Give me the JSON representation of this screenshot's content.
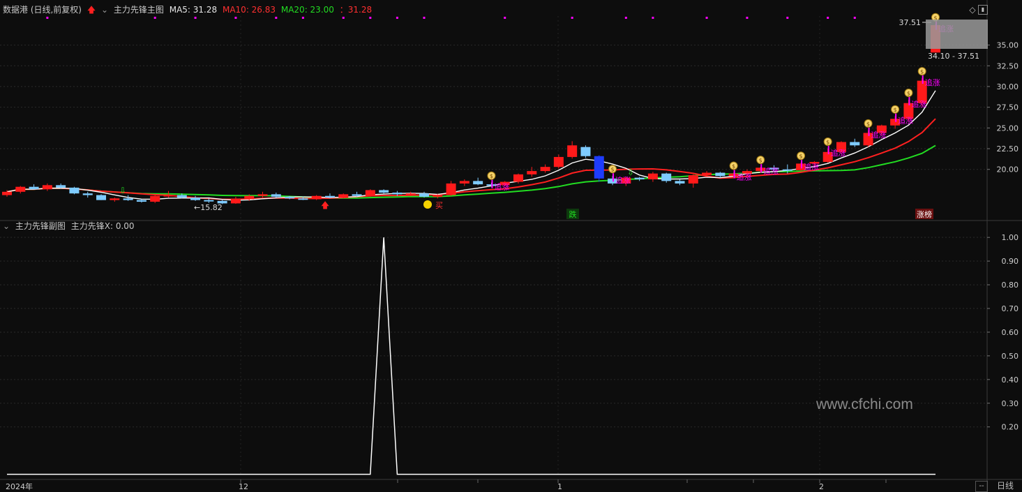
{
  "main_header": {
    "title": "数据港 (日线,前复权)",
    "indicator": "主力先锋主图",
    "ma5": "MA5: 31.28",
    "ma10": "MA10: 26.83",
    "ma20": "MA20: 23.00",
    "extra": "：31.28"
  },
  "sub_header": {
    "indicator": "主力先锋副图",
    "value": "主力先锋X: 0.00"
  },
  "annotations": {
    "high_value": "37.51",
    "range_label": "34.10 - 37.51",
    "low_value": "←15.82",
    "buy": "买",
    "fall": "跌",
    "limit_board": "涨榜",
    "chase": "追涨"
  },
  "footer": {
    "year": "2024年",
    "dec": "12",
    "jan": "1",
    "feb": "2",
    "period_button": "日线",
    "dash_button": "--"
  },
  "watermark": "www.cfchi.com",
  "colors": {
    "background": "#0d0d0d",
    "up": "#ff1a1a",
    "down_light": "#7ecbff",
    "down_blue": "#1e3cff",
    "ma5": "#ffffff",
    "ma10": "#ff2020",
    "ma20": "#22dd22",
    "signal": "#ff00ff"
  },
  "chart_data": [
    {
      "type": "candlestick",
      "title": "主力先锋主图",
      "y_ticks": [
        20.0,
        22.5,
        25.0,
        27.5,
        30.0,
        32.5,
        35.0
      ],
      "ylim": [
        14,
        38.5
      ],
      "x_labels": [
        "2024年",
        "12",
        "1",
        "2"
      ],
      "ohlc": [
        [
          16.9,
          17.5,
          16.7,
          17.3
        ],
        [
          17.3,
          18.0,
          17.1,
          17.9
        ],
        [
          17.9,
          18.2,
          17.6,
          17.6
        ],
        [
          17.6,
          18.3,
          17.4,
          18.1
        ],
        [
          18.1,
          18.3,
          17.7,
          17.8
        ],
        [
          17.8,
          17.9,
          17.0,
          17.1
        ],
        [
          17.1,
          17.3,
          16.6,
          16.9
        ],
        [
          16.9,
          17.0,
          16.3,
          16.3
        ],
        [
          16.3,
          16.6,
          16.1,
          16.5
        ],
        [
          16.5,
          16.9,
          16.2,
          16.3
        ],
        [
          16.3,
          16.4,
          16.0,
          16.1
        ],
        [
          16.1,
          16.9,
          15.95,
          16.8
        ],
        [
          16.8,
          17.4,
          16.6,
          16.9
        ],
        [
          16.9,
          17.1,
          16.5,
          16.6
        ],
        [
          16.6,
          16.8,
          16.2,
          16.3
        ],
        [
          16.3,
          16.5,
          15.95,
          16.2
        ],
        [
          16.2,
          16.3,
          15.82,
          15.9
        ],
        [
          15.9,
          16.7,
          15.85,
          16.4
        ],
        [
          16.4,
          17.0,
          16.2,
          16.8
        ],
        [
          16.8,
          17.3,
          16.6,
          17.0
        ],
        [
          17.0,
          17.2,
          16.6,
          16.7
        ],
        [
          16.7,
          16.8,
          16.4,
          16.5
        ],
        [
          16.5,
          16.7,
          16.3,
          16.4
        ],
        [
          16.4,
          16.9,
          16.3,
          16.8
        ],
        [
          16.8,
          17.1,
          16.5,
          16.6
        ],
        [
          16.6,
          17.1,
          16.5,
          17.0
        ],
        [
          17.0,
          17.3,
          16.7,
          16.8
        ],
        [
          16.8,
          17.6,
          16.7,
          17.5
        ],
        [
          17.5,
          17.6,
          17.1,
          17.2
        ],
        [
          17.2,
          17.4,
          16.8,
          17.0
        ],
        [
          17.0,
          17.3,
          16.8,
          17.1
        ],
        [
          17.1,
          17.3,
          16.6,
          16.7
        ],
        [
          16.7,
          17.0,
          16.5,
          16.9
        ],
        [
          16.9,
          18.6,
          16.8,
          18.3
        ],
        [
          18.3,
          18.8,
          18.0,
          18.6
        ],
        [
          18.6,
          19.0,
          18.1,
          18.2
        ],
        [
          18.2,
          18.4,
          17.9,
          18.1
        ],
        [
          18.1,
          18.6,
          18.0,
          18.5
        ],
        [
          18.5,
          19.5,
          18.3,
          19.4
        ],
        [
          19.4,
          20.3,
          19.1,
          19.8
        ],
        [
          19.8,
          20.6,
          19.6,
          20.3
        ],
        [
          20.3,
          21.8,
          20.1,
          21.5
        ],
        [
          21.5,
          23.4,
          21.3,
          22.9
        ],
        [
          22.7,
          22.9,
          21.4,
          21.6
        ],
        [
          21.6,
          21.7,
          18.5,
          18.9
        ],
        [
          18.9,
          19.2,
          18.1,
          18.3
        ],
        [
          18.3,
          19.1,
          18.0,
          19.0
        ],
        [
          19.0,
          19.1,
          18.6,
          18.8
        ],
        [
          18.8,
          19.7,
          18.5,
          19.5
        ],
        [
          19.5,
          19.6,
          18.4,
          18.6
        ],
        [
          18.6,
          18.8,
          18.1,
          18.3
        ],
        [
          18.3,
          19.4,
          17.8,
          19.3
        ],
        [
          19.3,
          19.8,
          19.1,
          19.6
        ],
        [
          19.6,
          19.7,
          19.0,
          19.2
        ],
        [
          19.2,
          19.6,
          19.0,
          19.5
        ],
        [
          19.5,
          20.0,
          19.3,
          19.8
        ],
        [
          19.8,
          20.3,
          19.6,
          20.2
        ],
        [
          20.2,
          20.5,
          19.8,
          20.0
        ],
        [
          20.0,
          20.6,
          19.5,
          19.9
        ],
        [
          19.9,
          20.8,
          19.8,
          20.7
        ],
        [
          20.7,
          21.0,
          20.4,
          20.9
        ],
        [
          20.9,
          22.5,
          20.8,
          22.1
        ],
        [
          22.1,
          23.4,
          21.9,
          23.3
        ],
        [
          23.3,
          23.7,
          22.7,
          22.9
        ],
        [
          22.9,
          24.7,
          22.7,
          24.4
        ],
        [
          24.4,
          25.4,
          24.1,
          25.3
        ],
        [
          25.3,
          26.4,
          24.9,
          26.1
        ],
        [
          26.1,
          28.4,
          25.9,
          28.0
        ],
        [
          28.0,
          31.0,
          27.6,
          30.7
        ],
        [
          34.1,
          37.51,
          34.1,
          37.4
        ]
      ],
      "ma_last": {
        "MA5": 31.28,
        "MA10": 26.83,
        "MA20": 23.0
      }
    },
    {
      "type": "line",
      "title": "主力先锋副图",
      "y_ticks": [
        0.2,
        0.3,
        0.4,
        0.5,
        0.6,
        0.7,
        0.8,
        0.9,
        1.0
      ],
      "ylim": [
        -0.01,
        1.03
      ],
      "series": [
        {
          "name": "主力先锋X",
          "spike_index": 28,
          "spike_value": 1.0,
          "baseline": 0.0
        }
      ]
    }
  ]
}
